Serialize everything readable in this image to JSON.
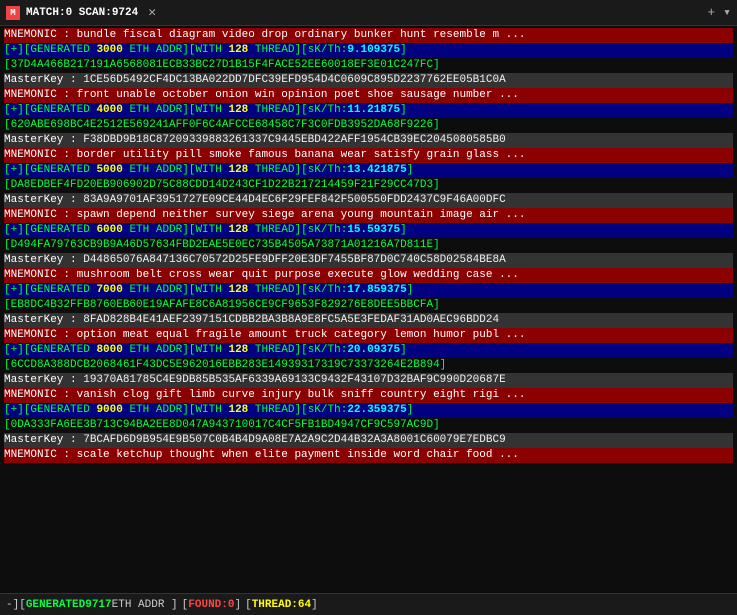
{
  "titleBar": {
    "icon": "M",
    "title": "MATCH:0 SCAN:9724",
    "closeLabel": "✕",
    "plusLabel": "+",
    "chevronLabel": "▾"
  },
  "entries": [
    {
      "type": "mnemonic",
      "text": "MNEMONIC : bundle fiscal diagram video drop ordinary bunker hunt resemble m ..."
    },
    {
      "type": "generated",
      "num": "3000",
      "coin": "ETH",
      "thread": "128",
      "skth": "9.109375"
    },
    {
      "type": "addr",
      "text": "37D4A466B217191A6568081ECB33BC27D1B15F4FACE52EE60018EF3E01C247FC"
    },
    {
      "type": "masterkey",
      "label": "MasterKey : ",
      "value": "1CE56D5492CF4DC13BA022DD7DFC39EFD954D4C0609C895D2237762EE05B1C0A"
    },
    {
      "type": "mnemonic",
      "text": "MNEMONIC : front unable october onion win opinion poet shoe sausage number ..."
    },
    {
      "type": "generated",
      "num": "4000",
      "coin": "ETH",
      "thread": "128",
      "skth": "11.21875"
    },
    {
      "type": "addr",
      "text": "620ABE698BC4E2512E569241AFF0F6C4AFCCE68458C7F3C0FDB3952DA68F9226"
    },
    {
      "type": "masterkey",
      "label": "MasterKey : ",
      "value": "F38DBD9B18C87209339883261337C9445EBD422AFF1954CB39EC2045080585B0"
    },
    {
      "type": "mnemonic",
      "text": "MNEMONIC : border utility pill smoke famous banana wear satisfy grain glass ..."
    },
    {
      "type": "generated",
      "num": "5000",
      "coin": "ETH",
      "thread": "128",
      "skth": "13.421875"
    },
    {
      "type": "addr",
      "text": "DA8EDBEF4FD20EB906902D75C88CDD14D243CF1D22B217214459F21F29CC47D3"
    },
    {
      "type": "masterkey",
      "label": "MasterKey : ",
      "value": "83A9A9701AF3951727E09CE44D4EC6F29FEF842F500550FDD2437C9F46A00DFC"
    },
    {
      "type": "mnemonic",
      "text": "MNEMONIC : spawn depend neither survey siege arena young mountain image air ..."
    },
    {
      "type": "generated",
      "num": "6000",
      "coin": "ETH",
      "thread": "128",
      "skth": "15.59375"
    },
    {
      "type": "addr",
      "text": "D494FA79763CB9B9A46D57634FBD2EAE5E0EC735B4505A73871A01216A7D811E"
    },
    {
      "type": "masterkey",
      "label": "MasterKey : ",
      "value": "D44865076A847136C70572D25FE9DFF20E3DF7455BF87D0C740C58D02584BE8A"
    },
    {
      "type": "mnemonic",
      "text": "MNEMONIC : mushroom belt cross wear quit purpose execute glow wedding case ..."
    },
    {
      "type": "generated",
      "num": "7000",
      "coin": "ETH",
      "thread": "128",
      "skth": "17.859375"
    },
    {
      "type": "addr",
      "text": "EB8DC4B32FFB8760EB60E19AFAFE8C6A81956CE9CF9653F829276E8DEE5BBCFA"
    },
    {
      "type": "masterkey",
      "label": "MasterKey : ",
      "value": "8FAD828B4E41AEF2397151CDBB2BA3B8A9E8FC5A5E3FEDAF31AD0AEC96BDD24"
    },
    {
      "type": "mnemonic",
      "text": "MNEMONIC : option meat equal fragile amount truck category lemon humor publ ..."
    },
    {
      "type": "generated",
      "num": "8000",
      "coin": "ETH",
      "thread": "128",
      "skth": "20.09375"
    },
    {
      "type": "addr",
      "text": "6CCD8A388DCB2068461F43DC5E962016EBB283E14939317319C73373264E2B894"
    },
    {
      "type": "masterkey",
      "label": "MasterKey : ",
      "value": "19370A81785C4E9DB85B535AF6339A69133C9432F43107D32BAF9C990D20687E"
    },
    {
      "type": "mnemonic",
      "text": "MNEMONIC : vanish clog gift limb curve injury bulk sniff country eight rigi ..."
    },
    {
      "type": "generated",
      "num": "9000",
      "coin": "ETH",
      "thread": "128",
      "skth": "22.359375"
    },
    {
      "type": "addr",
      "text": "0DA333FA6EE3B713C94BA2EE8D047A943710017C4CF5FB1BD4947CF9C597AC9D"
    },
    {
      "type": "masterkey",
      "label": "MasterKey : ",
      "value": "7BCAFD6D9B954E9B507C0B4B4D9A08E7A2A9C2D44B32A3A8001C60079E7EDBC9"
    },
    {
      "type": "mnemonic",
      "text": "MNEMONIC : scale ketchup thought when elite payment inside word chair food ..."
    }
  ],
  "statusBar": {
    "prefix": "-][",
    "genLabel": "GENERATED",
    "genNum": "9717",
    "coinLabel": "ETH ADDR",
    "foundLabel": "FOUND:",
    "foundNum": "0",
    "threadLabel": "THREAD:",
    "threadNum": "64",
    "suffix": "]"
  }
}
